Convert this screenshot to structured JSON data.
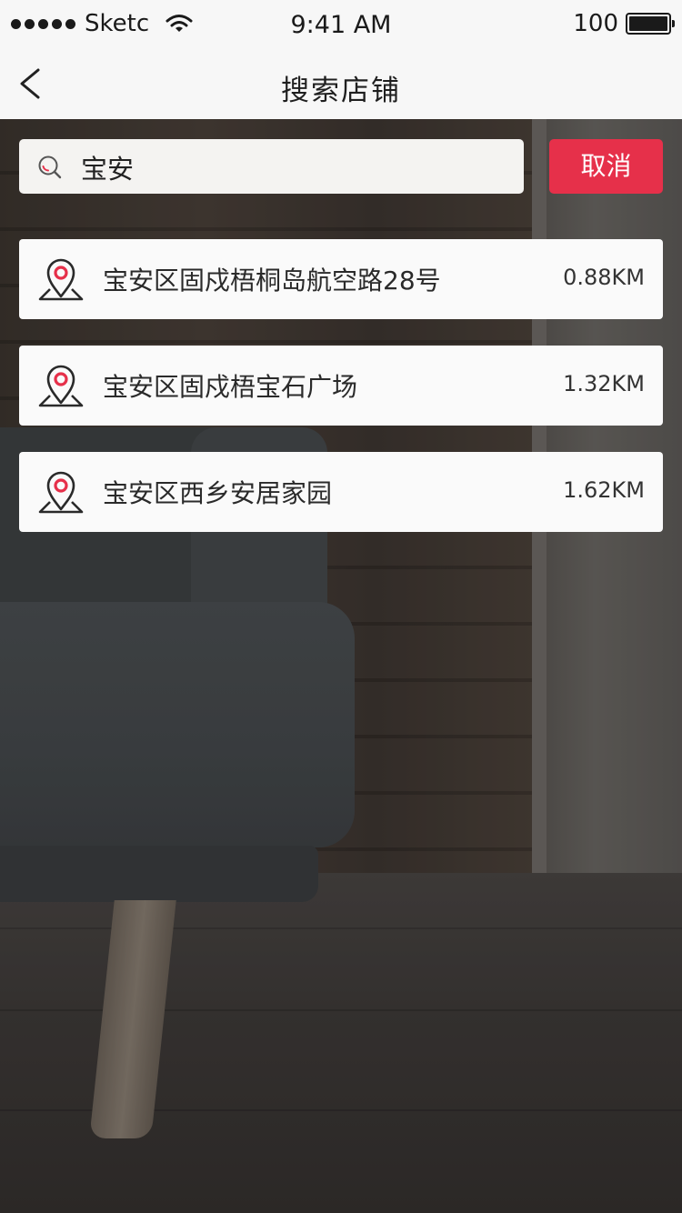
{
  "status_bar": {
    "carrier": "Sketc",
    "time": "9:41 AM",
    "battery": "100"
  },
  "nav": {
    "title": "搜索店铺"
  },
  "search": {
    "value": "宝安",
    "cancel_label": "取消"
  },
  "results": [
    {
      "address": "宝安区固戍梧桐岛航空路28号",
      "distance": "0.88KM"
    },
    {
      "address": "宝安区固戍梧宝石广场",
      "distance": "1.32KM"
    },
    {
      "address": "宝安区西乡安居家园",
      "distance": "1.62KM"
    }
  ],
  "colors": {
    "accent": "#e6304a",
    "bar_background": "#f7f7f7",
    "card_background": "#fafafa"
  },
  "icons": {
    "back": "chevron-left-icon",
    "search": "search-icon",
    "location": "location-pin-icon"
  }
}
